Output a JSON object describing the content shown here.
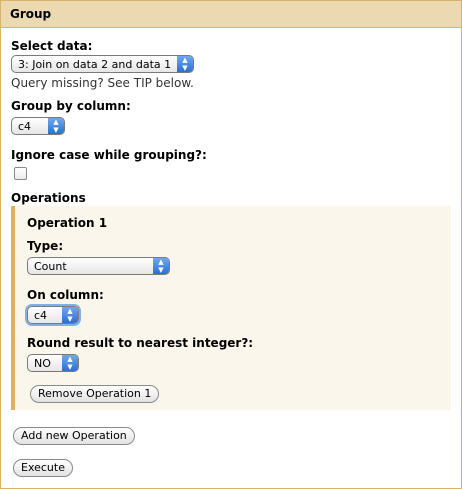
{
  "panel": {
    "title": "Group"
  },
  "select_data": {
    "label": "Select data:",
    "value": "3: Join on data 2 and data 1",
    "help": "Query missing? See TIP below."
  },
  "group_by": {
    "label": "Group by column:",
    "value": "c4"
  },
  "ignore_case": {
    "label": "Ignore case while grouping?:",
    "checked": false
  },
  "operations": {
    "title": "Operations",
    "items": [
      {
        "title": "Operation 1",
        "type_label": "Type:",
        "type_value": "Count",
        "column_label": "On column:",
        "column_value": "c4",
        "round_label": "Round result to nearest integer?:",
        "round_value": "NO",
        "remove_label": "Remove Operation 1"
      }
    ],
    "add_label": "Add new Operation"
  },
  "execute_label": "Execute",
  "colors": {
    "header_bg": "#ebd9b2",
    "border": "#d8b365",
    "accent": "#2b6fd1"
  }
}
